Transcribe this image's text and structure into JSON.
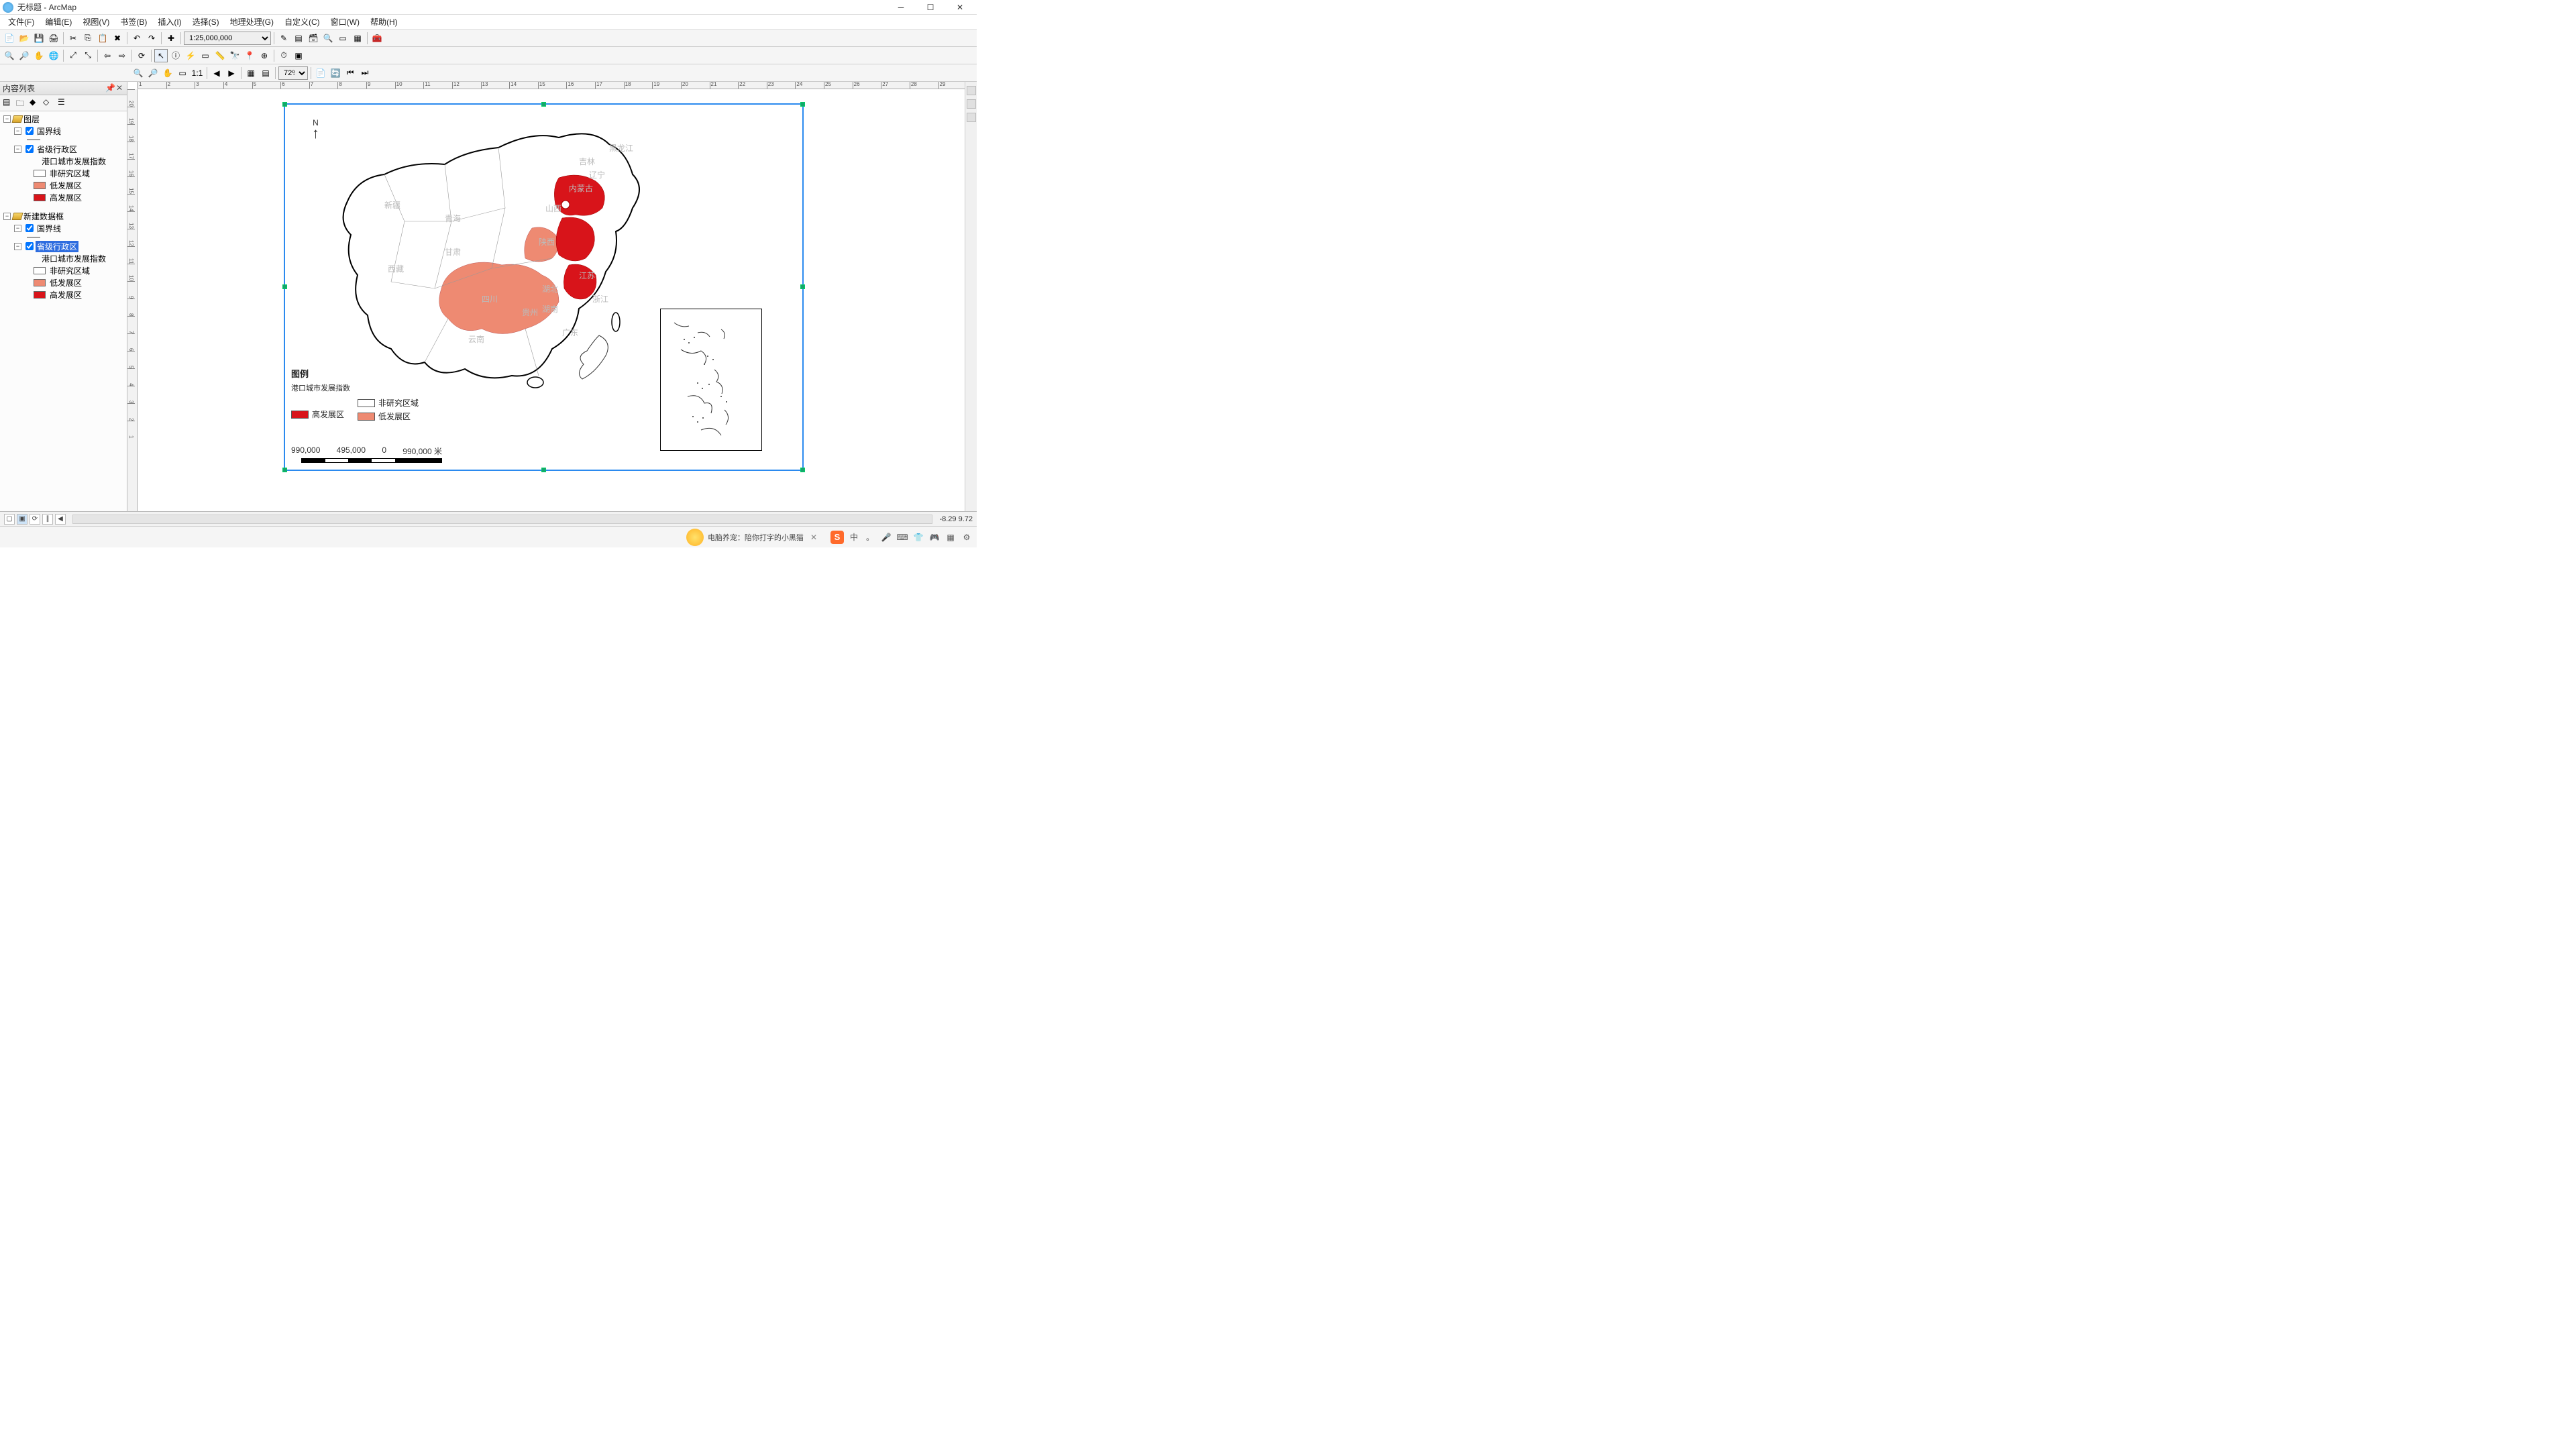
{
  "window": {
    "title": "无标题 - ArcMap"
  },
  "menu": {
    "items": [
      "文件(F)",
      "编辑(E)",
      "视图(V)",
      "书签(B)",
      "插入(I)",
      "选择(S)",
      "地理处理(G)",
      "自定义(C)",
      "窗口(W)",
      "帮助(H)"
    ]
  },
  "toolbar1": {
    "scale": "1:25,000,000"
  },
  "toolbar3": {
    "zoom": "72%"
  },
  "toc": {
    "title": "内容列表",
    "frame1": {
      "name": "图层",
      "layer1": "国界线",
      "layer2": "省级行政区",
      "layer2_field": "港口城市发展指数",
      "class1": "非研究区域",
      "class2": "低发展区",
      "class3": "高发展区"
    },
    "frame2": {
      "name": "新建数据框",
      "layer1": "国界线",
      "layer2": "省级行政区",
      "layer2_field": "港口城市发展指数",
      "class1": "非研究区域",
      "class2": "低发展区",
      "class3": "高发展区"
    }
  },
  "ruler": {
    "h": [
      "1",
      "2",
      "3",
      "4",
      "5",
      "6",
      "7",
      "8",
      "9",
      "10",
      "11",
      "12",
      "13",
      "14",
      "15",
      "16",
      "17",
      "18",
      "19",
      "20",
      "21",
      "22",
      "23",
      "24",
      "25",
      "26",
      "27",
      "28",
      "29"
    ],
    "v": [
      "20",
      "19",
      "18",
      "17",
      "16",
      "15",
      "14",
      "13",
      "12",
      "11",
      "10",
      "9",
      "8",
      "7",
      "6",
      "5",
      "4",
      "3",
      "2",
      "1"
    ]
  },
  "legend": {
    "title": "图例",
    "subtitle": "港口城市发展指数",
    "item1": "非研究区域",
    "item2": "高发展区",
    "item3": "低发展区"
  },
  "north": {
    "label": "N"
  },
  "scalebar": {
    "l0": "990,000",
    "l1": "495,000",
    "l2": "0",
    "l3": "990,000 米"
  },
  "status": {
    "coords": "-8.29  9.72"
  },
  "taskbar": {
    "msg": "电脑养宠：陪你打字的小黑猫",
    "ime": "中"
  },
  "colors": {
    "high": "#d8141a",
    "low": "#ee8a72",
    "none": "#ffffff"
  }
}
